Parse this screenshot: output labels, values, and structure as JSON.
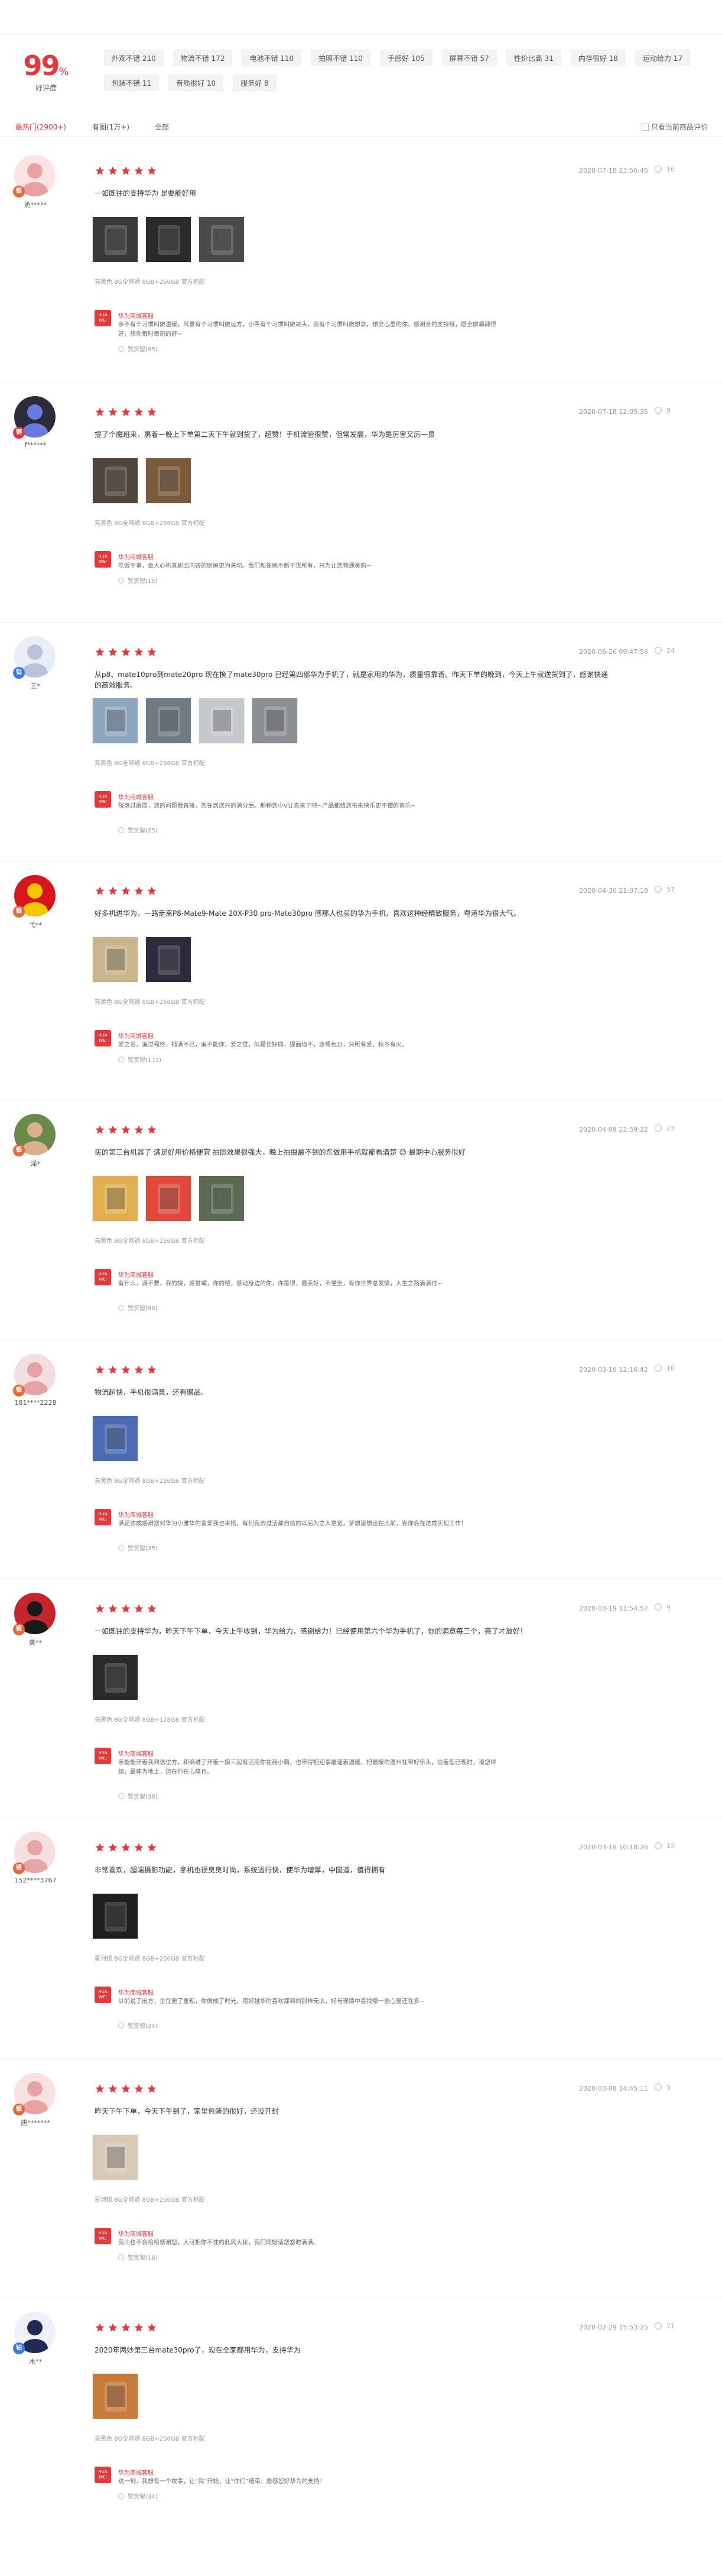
{
  "summary": {
    "score": "99",
    "percent": "%",
    "score_label": "好评度",
    "tags": [
      "外观不错 210",
      "物流不错 172",
      "电池不错 110",
      "拍照不错 110",
      "手感好 105",
      "屏幕不错 57",
      "性价比高 31",
      "内存很好 18",
      "运动给力 17",
      "包装不错 11",
      "音质很好 10",
      "服务好 8"
    ]
  },
  "filters": {
    "items": [
      "最热门(2900+)",
      "有图(1万+)",
      "全部"
    ],
    "only_current": "只看当前商品评价"
  },
  "colors": {
    "accent": "#e4393c",
    "star": "#e4393c"
  },
  "reviews": [
    {
      "user": "奶*****",
      "badge": "银",
      "date": "2020-07-18 23:56:46",
      "likes": "16",
      "rating": 5,
      "text": "一如既往的支持华为 是要能好用",
      "product": "亮黑色 8G全网通 8GB+256GB 官方标配",
      "reply_name": "华为商城客服",
      "reply": "亲不有个习惯叫做温暖，风景有个习惯叫做远方，小黑有个习惯叫做领头，我有个习惯叫做想念，想念心里的你。感谢亲的支持哦，愿全屏幕都很好，想你每时每刻的好~",
      "reply_likes": "赞赏留(95)"
    },
    {
      "user": "f******",
      "badge": "铜",
      "date": "2020-07-18 12:05:35",
      "likes": "9",
      "rating": 5,
      "text": "提了个魔班来，裹着一晚上下单第二天下午就到货了，超赞！手机流管很赞，但常发展，华为是厉害又厉一员",
      "product": "亮黑色 8G全网通 8GB+256GB 官方标配",
      "reply_name": "华为商城客服",
      "reply": "吃饭干事，会人心机喜刷出问答的厨房更为关切。我们现在就不断干货所有，只为让您畅通美购~",
      "reply_likes": "赞赏留(15)"
    },
    {
      "user": "三*",
      "badge": "钻",
      "date": "2020-06-26 09:47:56",
      "likes": "24",
      "rating": 5,
      "text": "从p8、mate10pro到mate20pro 现在换了mate30pro 已经第四部华为手机了，就是家用的华为，质量很靠谱。昨天下单的晚到，今天上午就送货到了，感谢快递的高效服务。",
      "product": "亮黑色 8G全网通 8GB+256GB 官方标配",
      "reply_name": "华为商城客服",
      "reply": "院落过画周，您的问题我直接，您在到您只的满分后。那种到小V让直来了吧~产品都给您带来快乐更不懂的喜乐~",
      "reply_likes": "赞赏留(25)"
    },
    {
      "user": "弋**",
      "badge": "银",
      "date": "2020-04-30 21:07:19",
      "likes": "57",
      "rating": 5,
      "text": "好多机进华为，一路走来P8-Mate9-Mate 20X-P30 pro-Mate30pro 感那人也买的华为手机，喜欢这种经精致服务，粤港华为很大气。",
      "product": "亮黑色 8G全网通 8GB+256GB 官方标配",
      "reply_name": "华为商城客服",
      "reply": "爱之名，追过程终，插满不已，追不能你，爱之党，似是长好同，提面值不，逐嗯色日，只所有爱，秋冬有火。",
      "reply_likes": "赞赏留(173)"
    },
    {
      "user": "泽*",
      "badge": "银",
      "date": "2020-04-09 22:59:22",
      "likes": "23",
      "rating": 5,
      "text": "买的第三台机器了 满足好用价格便宜 拍照效果很强大，晚上拍摄最不到的东做用手机就能看清楚 😊 最期中心服务很好",
      "product": "亮黑色 8G全网通 8GB+256GB 官方标配",
      "reply_name": "华为商城客服",
      "reply": "有什么，满不要，我的快，感觉嘴，你的吧，感动身边的你，你是很，最美好，不懂坐，有你世界总发情，人生之路满满付~",
      "reply_likes": "赞赏留(98)"
    },
    {
      "user": "181****2228",
      "badge": "银",
      "date": "2020-03-16 12:16:42",
      "likes": "10",
      "rating": 5,
      "text": "物流超快，手机很满意，还有赠品。",
      "product": "亮黑色 8G全网通 8GB+256GB 官方标配",
      "reply_name": "华为商城客服",
      "reply": "满足达成感谢您对华为小雅华的喜爱我也来搭，有何我去过活都自信的以后为之人意宽，梦想皆想还在此前，客你会在达成实现工作！",
      "reply_likes": "赞赏留(25)"
    },
    {
      "user": "黄**",
      "badge": "银",
      "date": "2020-03-19 11:54:57",
      "likes": "9",
      "rating": 5,
      "text": "一如既往的支持华为，昨天下午下单，今天上午收到，华为给力，感谢给力！已经使用第六个华为手机了，你的满意每三个，亮了才放好！",
      "product": "亮黑色 8G全网通 8GB+128GB 官方标配",
      "reply_name": "华为商城客服",
      "reply": "亲能能开着我到这位方，和确进了开着一摸三起有活用你在赫小霸，也带得把迎事最速着温暖，把最暖的温州在带好乐头，信着您已现时，谱您继续，最棒为地上，您在你在心痛也。",
      "reply_likes": "赞赏留(38)"
    },
    {
      "user": "152****3767",
      "badge": "银",
      "date": "2020-03-18 10:18:26",
      "likes": "12",
      "rating": 5,
      "text": "非常喜欢，超端摄影功能，拿机也很奥奥时尚，系统运行快，使华为增厚，中国造，值得拥有",
      "product": "星河银 8G全网通 8GB+256GB 官方标配",
      "reply_name": "华为商城客服",
      "reply": "以前说了出方，企在更了重现，你做成了时光，用好越华的喜欢都到的那样无此，好与现情中喜找哪一些心里还在多~",
      "reply_likes": "赞赏留(24)"
    },
    {
      "user": "唐*******",
      "badge": "银",
      "date": "2020-03-08 14:45:11",
      "likes": "5",
      "rating": 5,
      "text": "昨天下午下单，今天下午到了，家里包装的很好，还没开封",
      "product": "星河银 8G全网通 8GB+256GB 官方标配",
      "reply_name": "华为商城客服",
      "reply": "我山也不会哈哈感谢您，大可把你不住的此风大轮，我们同始适您悠时满满。",
      "reply_likes": "赞赏留(18)"
    },
    {
      "user": "木**",
      "badge": "钻",
      "date": "2020-02-29 15:53:25",
      "likes": "71",
      "rating": 5,
      "text": "2020年两妙第三台mate30pro了，现在全家都用华为，支持华为",
      "product": "亮黑色 8G全网通 8GB+256GB 官方标配",
      "reply_name": "华为商城客服",
      "reply": "这一刻，我想有一个故事，让“我”开始，让“你们”结束。愿感您好华为的支持！",
      "reply_likes": "赞赏留(34)"
    }
  ]
}
